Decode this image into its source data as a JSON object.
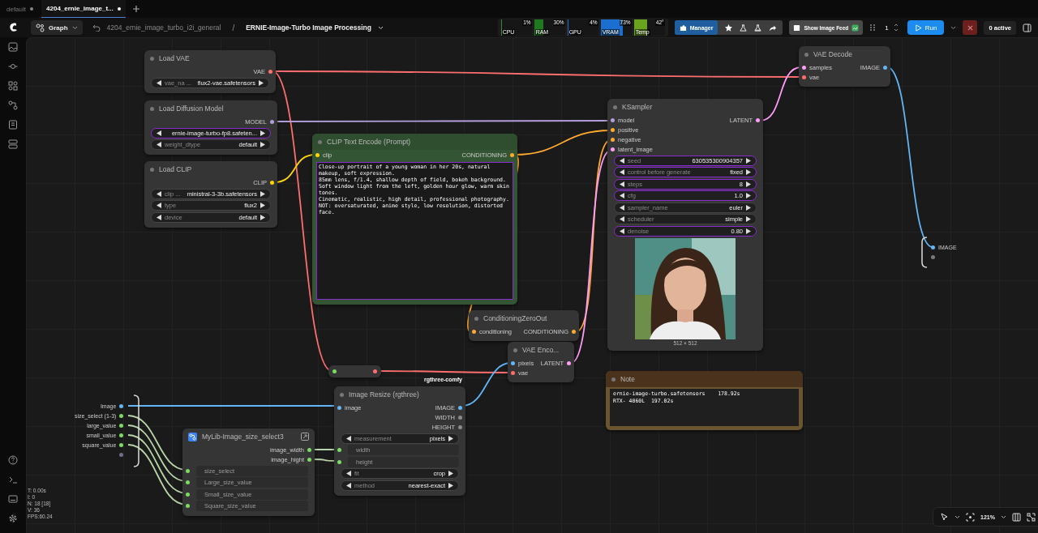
{
  "tabs": [
    {
      "label": "default",
      "selected": false,
      "unsaved": true
    },
    {
      "label": "4204_ernie_image_t...",
      "selected": true,
      "unsaved": true
    }
  ],
  "toolbar": {
    "mode": "Graph",
    "breadcrumb": "4204_ernie_image_turbo_i2i_general",
    "separator": "/",
    "workflow_title": "ERNIE-Image-Turbo Image Processing"
  },
  "monitor": [
    {
      "label": "CPU",
      "reading": "1%",
      "level": 0.01,
      "color": "#2e8b2e"
    },
    {
      "label": "RAM",
      "reading": "30%",
      "level": 0.3,
      "color": "#1f7a1f"
    },
    {
      "label": "GPU",
      "reading": "4%",
      "level": 0.04,
      "color": "#1c6fd1"
    },
    {
      "label": "VRAM",
      "reading": "73%",
      "level": 0.73,
      "color": "#1c6fd1"
    },
    {
      "label": "Temp",
      "reading": "42°",
      "level": 0.42,
      "color": "#6aa41e"
    }
  ],
  "manager": {
    "label": "Manager"
  },
  "image_feed": {
    "label": "Show Image Feed"
  },
  "queue": {
    "count": "1"
  },
  "run": {
    "label": "Run"
  },
  "active": "0 active",
  "graph_inputs": [
    {
      "label": "Image",
      "color": "#64b5f6"
    },
    {
      "label": "size_select (1-3)",
      "color": "#7bdb62"
    },
    {
      "label": "large_value",
      "color": "#7bdb62"
    },
    {
      "label": "small_value",
      "color": "#7bdb62"
    },
    {
      "label": "square_value",
      "color": "#7bdb62"
    },
    {
      "color": "#6f6f8a"
    }
  ],
  "graph_outputs": [
    {
      "label": "IMAGE",
      "color": "#64b5f6"
    },
    {
      "color": "#7a7a7a"
    }
  ],
  "nodes": [
    {
      "kind": "node",
      "title": "Load VAE",
      "outputs": [
        {
          "label": "VAE",
          "color": "#ff6e6e"
        }
      ],
      "widgets": [
        {
          "kind": "combo",
          "label": "vae_na ...",
          "value": "flux2-vae.safetensors",
          "highlighted": false
        }
      ]
    },
    {
      "kind": "node",
      "title": "Load Diffusion Model",
      "outputs": [
        {
          "label": "MODEL",
          "color": "#b39ddb"
        }
      ],
      "widgets": [
        {
          "kind": "combo",
          "value": "ernie-image-turbo-fp8.safeten...",
          "highlighted": true
        },
        {
          "kind": "combo",
          "label": "weight_dtype",
          "value": "default",
          "highlighted": false
        }
      ]
    },
    {
      "kind": "node",
      "title": "Load CLIP",
      "outputs": [
        {
          "label": "CLIP",
          "color": "#ffd500"
        }
      ],
      "widgets": [
        {
          "kind": "combo",
          "label": "clip ...",
          "value": "ministral-3-3b.safetensors",
          "highlighted": false
        },
        {
          "kind": "combo",
          "label": "type",
          "value": "flux2",
          "highlighted": false
        },
        {
          "kind": "combo",
          "label": "device",
          "value": "default",
          "highlighted": false
        }
      ]
    },
    {
      "kind": "subgraph",
      "title": "MyLib-Image_size_select3",
      "outputs": [
        {
          "label": "image_width",
          "color": "#7bdb62"
        },
        {
          "label": "image_hight",
          "color": "#7bdb62"
        }
      ],
      "widgets": [
        {
          "kind": "linked",
          "label": "size_select",
          "color": "#7bdb62"
        },
        {
          "kind": "linked",
          "label": "Large_size_value",
          "color": "#7bdb62"
        },
        {
          "kind": "linked",
          "label": "Small_size_value",
          "color": "#7bdb62"
        },
        {
          "kind": "linked",
          "label": "Square_size_value",
          "color": "#7bdb62"
        }
      ]
    },
    {
      "kind": "prompt",
      "title": "CLIP Text Encode (Prompt)",
      "inputs": [
        {
          "label": "clip",
          "color": "#ffd500"
        }
      ],
      "outputs": [
        {
          "label": "CONDITIONING",
          "color": "#ffa931"
        }
      ],
      "text": "Close-up portrait of a young woman in her 20s, natural makeup, soft expression.\n85mm lens, f/1.4, shallow depth of field, bokeh background.\nSoft window light from the left, golden hour glow, warm skin tones.\nCinematic, realistic, high detail, professional photography.\nNOT: oversaturated, anime style, low resolution, distorted face."
    },
    {
      "kind": "reroute",
      "inputs": [
        {
          "color": "#7bdb62"
        }
      ],
      "outputs": [
        {
          "color": "#ff6e6e"
        }
      ]
    },
    {
      "kind": "node",
      "title": "Image Resize (rgthree)",
      "badge": "rgthree-comfy",
      "inputs": [
        {
          "label": "image",
          "color": "#64b5f6"
        }
      ],
      "outputs": [
        {
          "label": "IMAGE",
          "color": "#64b5f6"
        },
        {
          "label": "WIDTH",
          "color": "#8a8a8a"
        },
        {
          "label": "HEIGHT",
          "color": "#8a8a8a"
        }
      ],
      "widgets": [
        {
          "kind": "combo",
          "label": "measurement",
          "value": "pixels",
          "highlighted": false
        },
        {
          "kind": "linked",
          "label": "width",
          "color": "#7bdb62"
        },
        {
          "kind": "linked",
          "label": "height",
          "color": "#7bdb62"
        },
        {
          "kind": "combo",
          "label": "fit",
          "value": "crop",
          "highlighted": false
        },
        {
          "kind": "combo",
          "label": "method",
          "value": "nearest-exact",
          "highlighted": false
        }
      ]
    },
    {
      "kind": "node",
      "title": "ConditioningZeroOut",
      "inputs": [
        {
          "label": "conditioning",
          "color": "#ffa931"
        }
      ],
      "outputs": [
        {
          "label": "CONDITIONING",
          "color": "#ffa931"
        }
      ]
    },
    {
      "kind": "node",
      "title": "VAE Enco...",
      "inputs": [
        {
          "label": "pixels",
          "color": "#64b5f6"
        },
        {
          "label": "vae",
          "color": "#ff6e6e"
        }
      ],
      "outputs": [
        {
          "label": "LATENT",
          "color": "#ff9cf9"
        }
      ]
    },
    {
      "kind": "node",
      "title": "KSampler",
      "inputs": [
        {
          "label": "model",
          "color": "#b39ddb"
        },
        {
          "label": "positive",
          "color": "#ffa931"
        },
        {
          "label": "negative",
          "color": "#ffa931"
        },
        {
          "label": "latent_image",
          "color": "#ff9cf9"
        }
      ],
      "outputs": [
        {
          "label": "LATENT",
          "color": "#ff9cf9"
        }
      ],
      "widgets": [
        {
          "kind": "combo",
          "label": "seed",
          "value": "630535300904357",
          "highlighted": true
        },
        {
          "kind": "combo",
          "label": "control before generate",
          "value": "fixed",
          "highlighted": true
        },
        {
          "kind": "combo",
          "label": "steps",
          "value": "8",
          "highlighted": true
        },
        {
          "kind": "combo",
          "label": "cfg",
          "value": "1.0",
          "highlighted": true
        },
        {
          "kind": "combo",
          "label": "sampler_name",
          "value": "euler",
          "highlighted": false
        },
        {
          "kind": "combo",
          "label": "scheduler",
          "value": "simple",
          "highlighted": false
        },
        {
          "kind": "combo",
          "label": "denoise",
          "value": "0.80",
          "highlighted": true
        }
      ],
      "preview": {
        "kind": "picture",
        "caption": "512 × 512"
      }
    },
    {
      "kind": "note",
      "title": "Note",
      "text": "ernie-image-turbo.safetensors    178.92s\nRTX- 4060L  197.02s"
    },
    {
      "kind": "node",
      "title": "VAE Decode",
      "inputs": [
        {
          "label": "samples",
          "color": "#ff9cf9"
        },
        {
          "label": "vae",
          "color": "#ff6e6e"
        }
      ],
      "outputs": [
        {
          "label": "IMAGE",
          "color": "#64b5f6"
        }
      ]
    }
  ],
  "canvas_stats": [
    "T: 0.00s",
    "I: 0",
    "N: 18 [18]",
    "V: 36",
    "FPS:60.24"
  ],
  "zoom": "121%"
}
